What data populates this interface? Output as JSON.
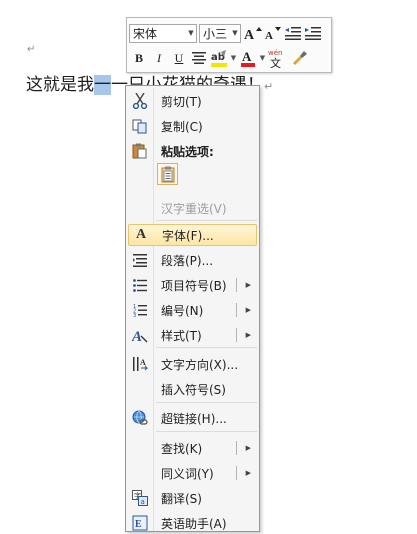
{
  "document": {
    "corner_mark": "↵",
    "text_before": "这就是我",
    "text_selected": "一",
    "text_after": "一只小花猫的奇遇！",
    "para_mark": "↵"
  },
  "mini_toolbar": {
    "font_name": "宋体",
    "font_size": "小三",
    "row1_icons": [
      "grow-font-icon",
      "shrink-font-icon",
      "decrease-indent-icon",
      "increase-indent-icon"
    ],
    "bold": "B",
    "italic": "I",
    "underline": "U",
    "font_color_letter": "A",
    "phonetic_label": "wén",
    "highlight_color": "#f2e600",
    "font_color": "#e8191f"
  },
  "context_menu": {
    "items": [
      {
        "label": "剪切(T)",
        "icon": "scissors-icon"
      },
      {
        "label": "复制(C)",
        "icon": "copy-icon"
      },
      {
        "label": "粘贴选项:",
        "icon": "clipboard-icon"
      },
      {
        "label": "汉字重选(V)",
        "disabled": true
      },
      {
        "label": "字体(F)...",
        "icon": "font-icon",
        "highlighted": true
      },
      {
        "label": "段落(P)...",
        "icon": "paragraph-icon"
      },
      {
        "label": "项目符号(B)",
        "icon": "bullets-icon",
        "submenu": true
      },
      {
        "label": "编号(N)",
        "icon": "numbering-icon",
        "submenu": true
      },
      {
        "label": "样式(T)",
        "icon": "styles-icon",
        "submenu": true
      },
      {
        "label": "文字方向(X)...",
        "icon": "text-direction-icon"
      },
      {
        "label": "插入符号(S)"
      },
      {
        "label": "超链接(H)...",
        "icon": "hyperlink-icon"
      },
      {
        "label": "查找(K)",
        "submenu": true
      },
      {
        "label": "同义词(Y)",
        "submenu": true
      },
      {
        "label": "翻译(S)",
        "icon": "translate-icon"
      },
      {
        "label": "英语助手(A)",
        "icon": "english-assistant-icon"
      }
    ]
  }
}
